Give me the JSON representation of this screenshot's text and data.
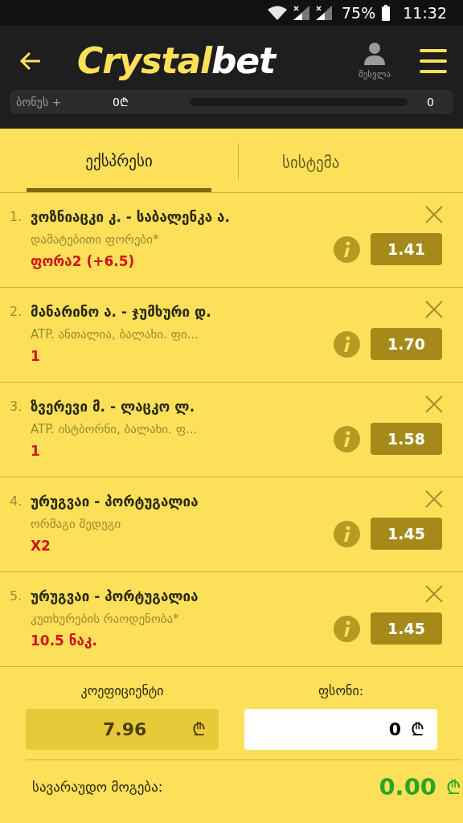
{
  "status_bar": {
    "battery": "75%",
    "time": "11:32"
  },
  "header": {
    "logo": [
      "Crystal",
      "bet"
    ],
    "login_label": "შესვლა"
  },
  "bonus": {
    "label": "ბონუს +",
    "amount": "0₾",
    "level": 0,
    "count": "0"
  },
  "tabs": [
    {
      "label": "ექსპრესი",
      "selected": true
    },
    {
      "label": "სისტემა",
      "selected": false
    }
  ],
  "bets": [
    {
      "number": "1.",
      "match": "ვოზნიაცკი კ. - საბალენკა ა.",
      "market": "დამატებითი ფორები*",
      "pick": "ფორა2 (+6.5)",
      "odds": "1.41"
    },
    {
      "number": "2.",
      "match": "მანარინო ა. - ჯუმხური დ.",
      "market": "ATP. ანთალია, ბალახი. ფი...",
      "pick": "1",
      "odds": "1.70"
    },
    {
      "number": "3.",
      "match": "ზვერევი მ. - ლაცკო ლ.",
      "market": "ATP. ისტბორნი, ბალახი. ფ...",
      "pick": "1",
      "odds": "1.58"
    },
    {
      "number": "4.",
      "match": "ურუგვაი - პორტუგალია",
      "market": "ორმაგი შედეგი",
      "pick": "X2",
      "odds": "1.45"
    },
    {
      "number": "5.",
      "match": "ურუგვაი - პორტუგალია",
      "market": "კუთხურების რაოდენობა*",
      "pick": "10.5 ნაკ.",
      "odds": "1.45"
    }
  ],
  "summary": {
    "coefficient_label": "კოეფიციენტი",
    "coefficient": "7.96",
    "coefficient_currency": "₾",
    "stake_label": "ფსონი:",
    "stake": "0",
    "stake_currency": "₾",
    "win_label": "სავარაუდო მოგება:",
    "win": "0.00",
    "win_currency": "₾"
  }
}
